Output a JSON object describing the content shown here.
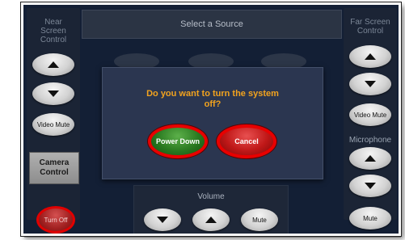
{
  "header": {
    "source_placeholder": "Select a Source"
  },
  "near_panel": {
    "title_line1": "Near",
    "title_line2": "Screen",
    "title_line3": "Control",
    "video_mute": "Video Mute",
    "camera_control_line1": "Camera",
    "camera_control_line2": "Control",
    "turn_off": "Turn Off"
  },
  "far_panel": {
    "title_line1": "Far Screen",
    "title_line2": "Control",
    "video_mute": "Video Mute",
    "microphone_label": "Microphone",
    "mic_mute": "Mute"
  },
  "volume": {
    "label": "Volume",
    "mute": "Mute"
  },
  "dialog": {
    "message_line1": "Do you want to turn the system",
    "message_line2": "off?",
    "power_down": "Power Down",
    "cancel": "Cancel"
  },
  "colors": {
    "background": "#131f35",
    "dialog_text": "#f2a31e",
    "highlight_ring": "#e80000",
    "power_down_button": "#2a7a20",
    "cancel_button": "#c01818"
  },
  "icons": {
    "up": "triangle-up-icon",
    "down": "triangle-down-icon"
  }
}
